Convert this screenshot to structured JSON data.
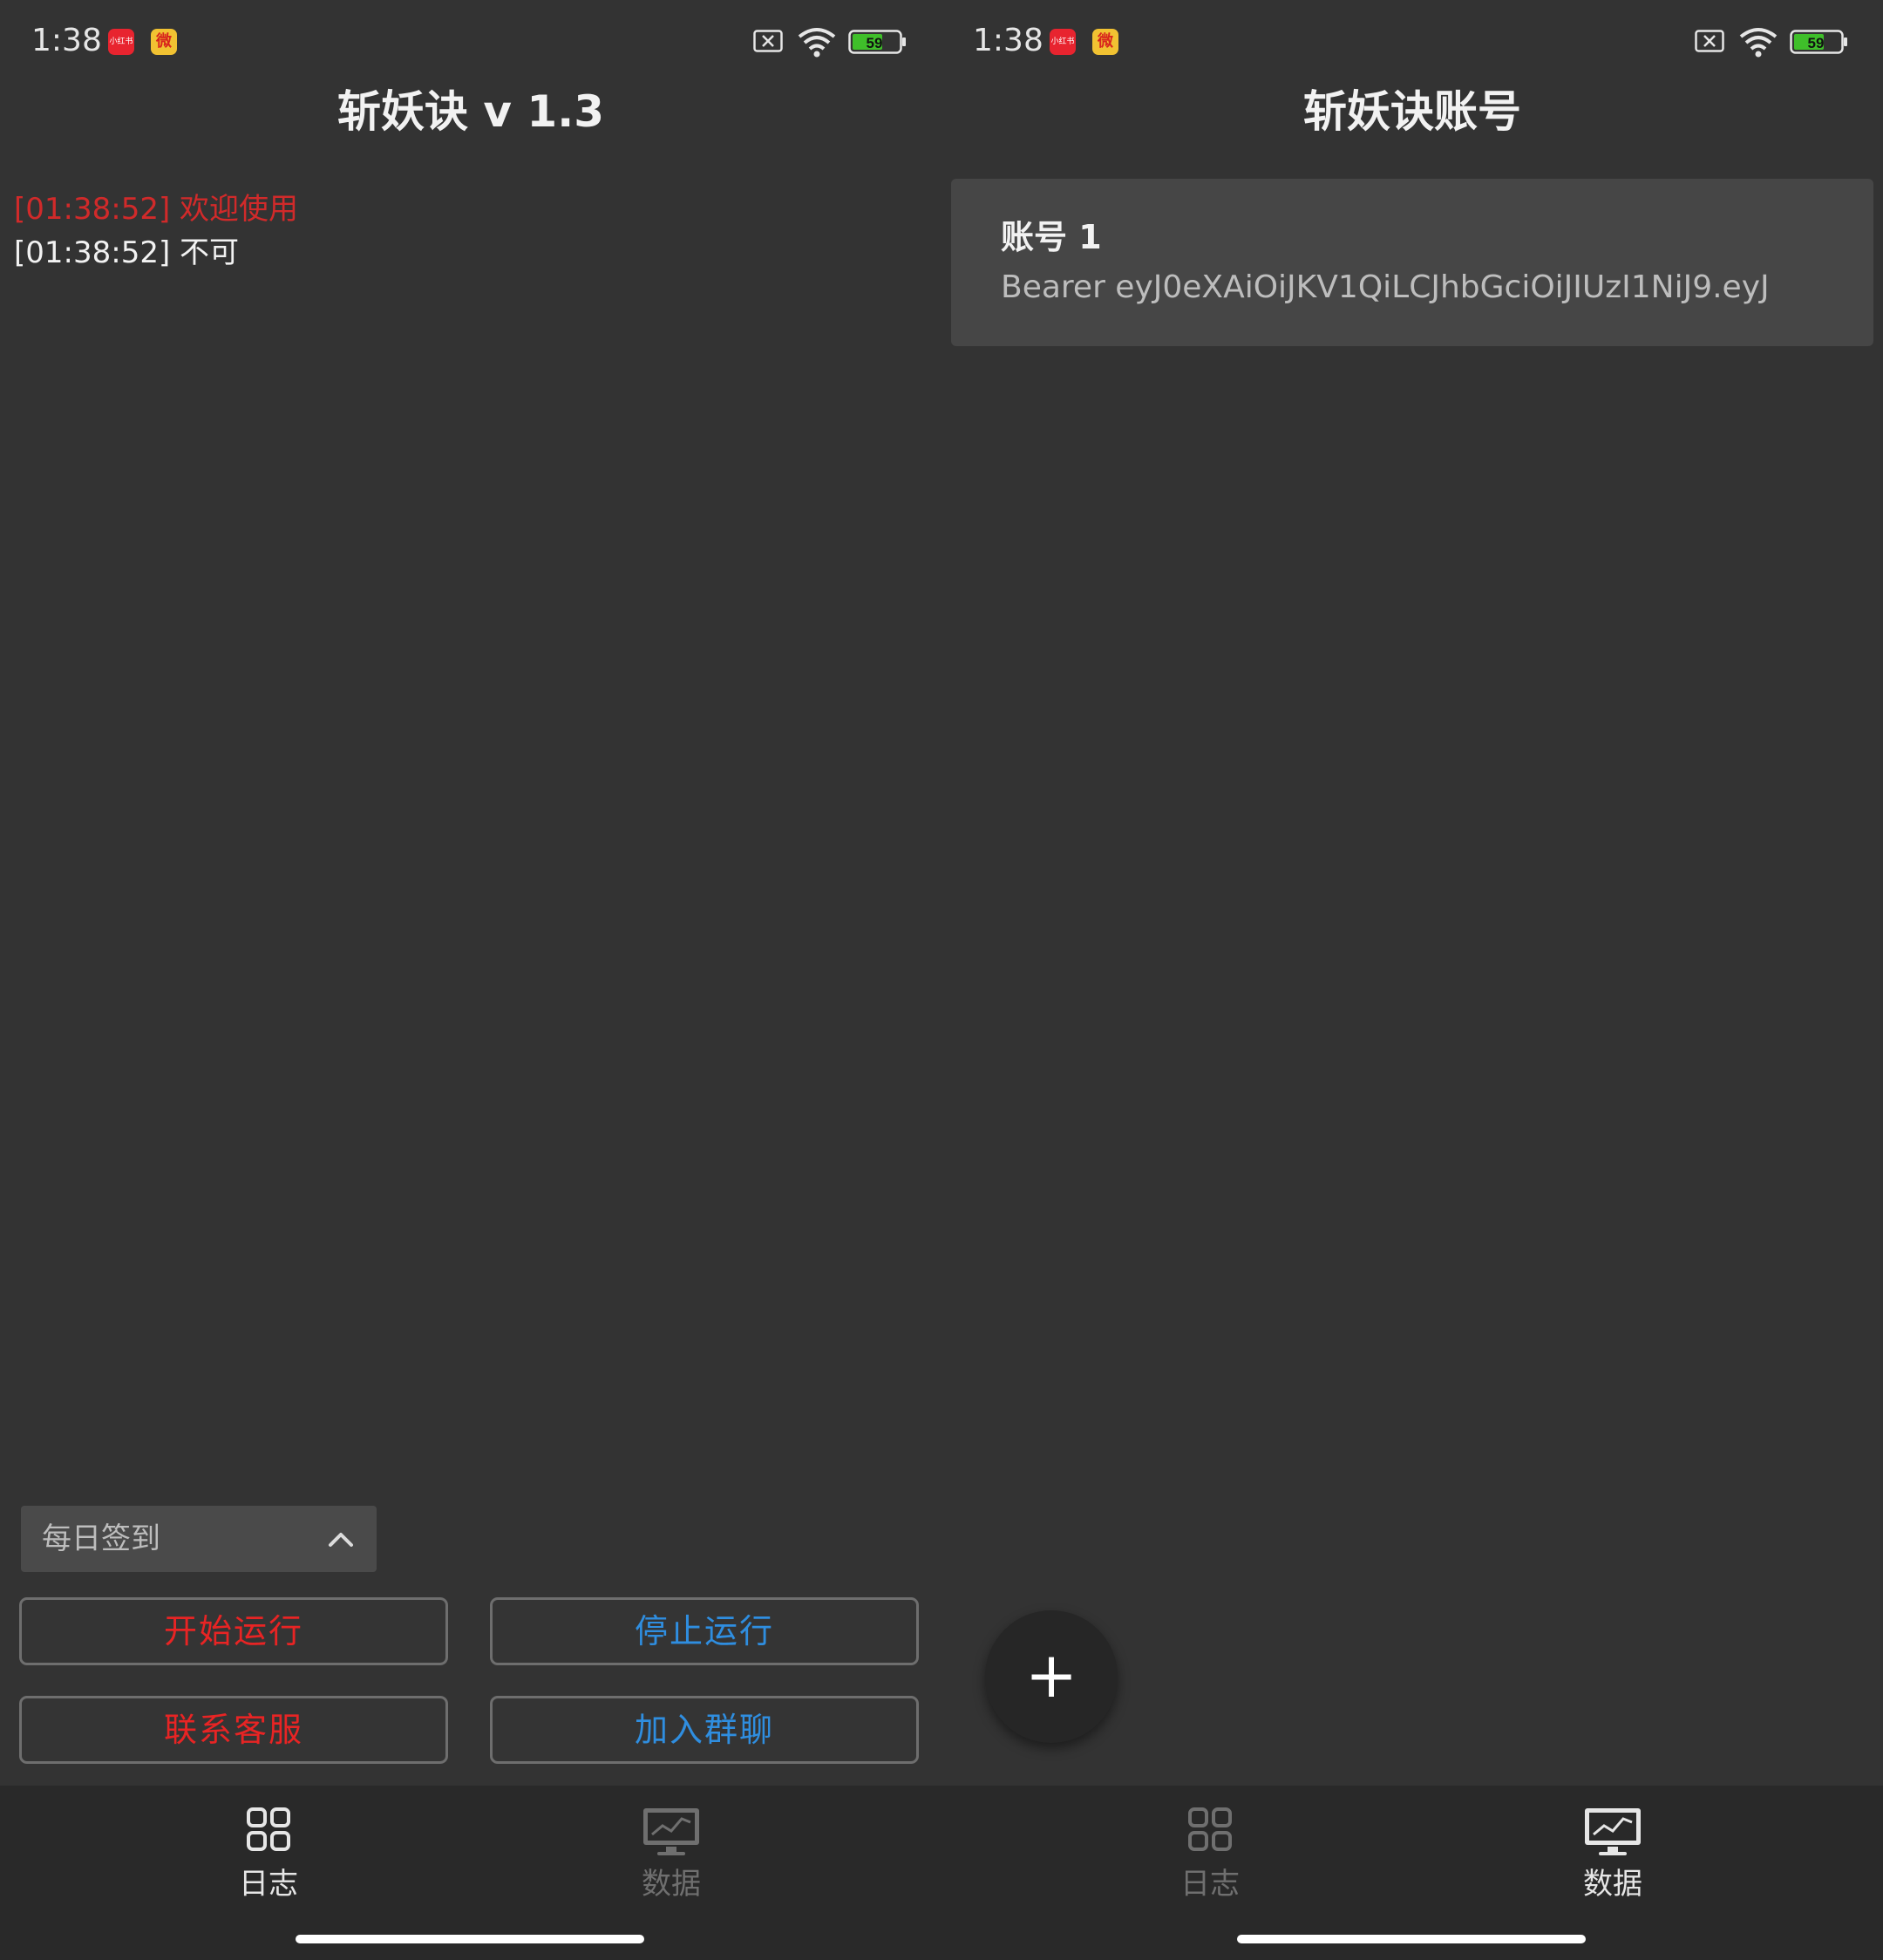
{
  "status_bar": {
    "time": "1:38",
    "app1_text": "小红书",
    "app2_text": "微",
    "battery": "59"
  },
  "left_screen": {
    "title": "斩妖诀 v 1.3",
    "log": [
      {
        "text": "[01:38:52] 欢迎使用",
        "color": "#d12a2a"
      },
      {
        "text": "[01:38:52] 不可",
        "color": "#f2f2f2"
      }
    ],
    "dropdown": {
      "value": "每日签到"
    },
    "buttons": {
      "start": "开始运行",
      "stop": "停止运行",
      "contact": "联系客服",
      "join": "加入群聊"
    }
  },
  "right_screen": {
    "title": "斩妖诀账号",
    "accounts": [
      {
        "name": "账号 1",
        "token": "Bearer eyJ0eXAiOiJKV1QiLCJhbGciOiJIUzI1NiJ9.eyJ"
      }
    ],
    "fab_label": "+"
  },
  "nav": {
    "log_label": "日志",
    "data_label": "数据"
  },
  "colors": {
    "background": "#333333",
    "accent_red": "#e82424",
    "accent_blue": "#2f8ee0",
    "nav_active": "#e6e6e6",
    "nav_inactive": "#6f6f6f"
  }
}
